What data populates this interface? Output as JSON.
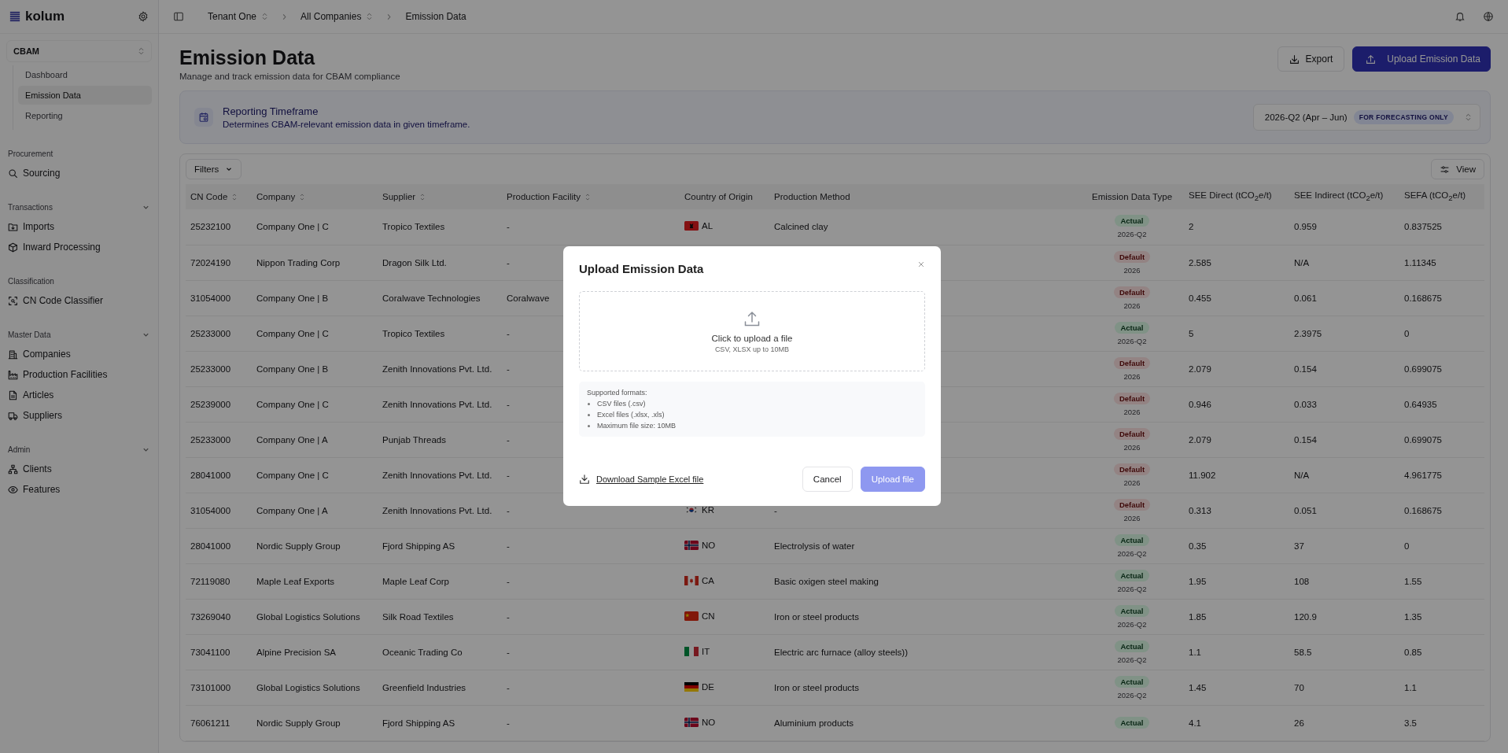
{
  "sidebar": {
    "brand": "kolum",
    "module": "CBAM",
    "module_items": [
      {
        "label": "Dashboard",
        "selected": false
      },
      {
        "label": "Emission Data",
        "selected": true
      },
      {
        "label": "Reporting",
        "selected": false
      }
    ],
    "groups": [
      {
        "title": "Procurement",
        "collapsible": false,
        "items": [
          {
            "label": "Sourcing",
            "kind": "search"
          }
        ]
      },
      {
        "title": "Transactions",
        "collapsible": true,
        "items": [
          {
            "label": "Imports",
            "kind": "folder"
          },
          {
            "label": "Inward Processing",
            "kind": "cube"
          }
        ]
      },
      {
        "title": "Classification",
        "collapsible": false,
        "items": [
          {
            "label": "CN Code Classifier",
            "kind": "scan"
          }
        ]
      },
      {
        "title": "Master Data",
        "collapsible": true,
        "items": [
          {
            "label": "Companies",
            "kind": "building"
          },
          {
            "label": "Production Facilities",
            "kind": "factory"
          },
          {
            "label": "Articles",
            "kind": "file"
          },
          {
            "label": "Suppliers",
            "kind": "truck"
          }
        ]
      },
      {
        "title": "Admin",
        "collapsible": true,
        "items": [
          {
            "label": "Clients",
            "kind": "network"
          },
          {
            "label": "Features",
            "kind": "eye"
          }
        ]
      }
    ]
  },
  "breadcrumb": [
    {
      "label": "Tenant One",
      "switcher": true
    },
    {
      "label": "All Companies",
      "switcher": true
    },
    {
      "label": "Emission Data",
      "switcher": false
    }
  ],
  "page": {
    "title": "Emission Data",
    "subtitle": "Manage and track emission data for CBAM compliance",
    "buttons": [
      {
        "label": "Export",
        "kind": "export"
      },
      {
        "label": "Upload Emission Data",
        "kind": "upload"
      }
    ]
  },
  "timeframe": {
    "title": "Reporting Timeframe",
    "description": "Determines CBAM-relevant emission data in given timeframe.",
    "value": "2026-Q2 (Apr – Jun)",
    "badge": "FOR FORECASTING ONLY"
  },
  "toolbar": {
    "filters": "Filters",
    "view": "View"
  },
  "table": {
    "columns": [
      {
        "label": "CN Code",
        "sortable": true
      },
      {
        "label": "Company",
        "sortable": true
      },
      {
        "label": "Supplier",
        "sortable": true
      },
      {
        "label": "Production Facility",
        "sortable": true
      },
      {
        "label": "Country of Origin",
        "sortable": false
      },
      {
        "label": "Production Method",
        "sortable": false
      },
      {
        "label": "Emission Data Type",
        "sortable": false
      },
      {
        "label": "SEE Direct (tCO$_{2}$e/t)",
        "sortable": false
      },
      {
        "label": "SEE Indirect (tCO$_{2}$e/t)",
        "sortable": false
      },
      {
        "label": "SEFA (tCO$_{2}$e/t)",
        "sortable": false
      }
    ],
    "rows": [
      {
        "cn": "25232100",
        "company": "Company One | C",
        "supplier": "Tropico Textiles",
        "facility": "-",
        "country": {
          "code": "AL",
          "kind": "al"
        },
        "method": "Calcined clay",
        "type": {
          "label": "Actual",
          "period": "2026-Q2",
          "kind": "actual"
        },
        "direct": "2",
        "indirect": "0.959",
        "sefa": "0.837525"
      },
      {
        "cn": "72024190",
        "company": "Nippon Trading Corp",
        "supplier": "Dragon Silk Ltd.",
        "facility": "-",
        "type": {
          "label": "Default",
          "period": "2026",
          "kind": "default"
        },
        "direct": "2.585",
        "indirect": "N/A",
        "sefa": "1.11345"
      },
      {
        "cn": "31054000",
        "company": "Company One | B",
        "supplier": "Coralwave Technologies",
        "facility": "Coralwave",
        "type": {
          "label": "Default",
          "period": "2026",
          "kind": "default"
        },
        "direct": "0.455",
        "indirect": "0.061",
        "sefa": "0.168675"
      },
      {
        "cn": "25233000",
        "company": "Company One | C",
        "supplier": "Tropico Textiles",
        "facility": "-",
        "type": {
          "label": "Actual",
          "period": "2026-Q2",
          "kind": "actual"
        },
        "direct": "5",
        "indirect": "2.3975",
        "sefa": "0"
      },
      {
        "cn": "25233000",
        "company": "Company One | B",
        "supplier": "Zenith Innovations Pvt. Ltd.",
        "facility": "-",
        "type": {
          "label": "Default",
          "period": "2026",
          "kind": "default"
        },
        "direct": "2.079",
        "indirect": "0.154",
        "sefa": "0.699075"
      },
      {
        "cn": "25239000",
        "company": "Company One | C",
        "supplier": "Zenith Innovations Pvt. Ltd.",
        "facility": "-",
        "type": {
          "label": "Default",
          "period": "2026",
          "kind": "default"
        },
        "direct": "0.946",
        "indirect": "0.033",
        "sefa": "0.64935"
      },
      {
        "cn": "25233000",
        "company": "Company One | A",
        "supplier": "Punjab Threads",
        "facility": "-",
        "type": {
          "label": "Default",
          "period": "2026",
          "kind": "default"
        },
        "direct": "2.079",
        "indirect": "0.154",
        "sefa": "0.699075"
      },
      {
        "cn": "28041000",
        "company": "Company One | C",
        "supplier": "Zenith Innovations Pvt. Ltd.",
        "facility": "-",
        "type": {
          "label": "Default",
          "period": "2026",
          "kind": "default"
        },
        "direct": "11.902",
        "indirect": "N/A",
        "sefa": "4.961775"
      },
      {
        "cn": "31054000",
        "company": "Company One | A",
        "supplier": "Zenith Innovations Pvt. Ltd.",
        "facility": "-",
        "country": {
          "code": "KR",
          "kind": "kr"
        },
        "method": "-",
        "type": {
          "label": "Default",
          "period": "2026",
          "kind": "default"
        },
        "direct": "0.313",
        "indirect": "0.051",
        "sefa": "0.168675"
      },
      {
        "cn": "28041000",
        "company": "Nordic Supply Group",
        "supplier": "Fjord Shipping AS",
        "facility": "-",
        "country": {
          "code": "NO",
          "kind": "no"
        },
        "method": "Electrolysis of water",
        "type": {
          "label": "Actual",
          "period": "2026-Q2",
          "kind": "actual"
        },
        "direct": "0.35",
        "indirect": "37",
        "sefa": "0"
      },
      {
        "cn": "72119080",
        "company": "Maple Leaf Exports",
        "supplier": "Maple Leaf Corp",
        "facility": "-",
        "country": {
          "code": "CA",
          "kind": "ca"
        },
        "method": "Basic oxigen steel making",
        "type": {
          "label": "Actual",
          "period": "2026-Q2",
          "kind": "actual"
        },
        "direct": "1.95",
        "indirect": "108",
        "sefa": "1.55"
      },
      {
        "cn": "73269040",
        "company": "Global Logistics Solutions",
        "supplier": "Silk Road Textiles",
        "facility": "-",
        "country": {
          "code": "CN",
          "kind": "cn"
        },
        "method": "Iron or steel products",
        "type": {
          "label": "Actual",
          "period": "2026-Q2",
          "kind": "actual"
        },
        "direct": "1.85",
        "indirect": "120.9",
        "sefa": "1.35"
      },
      {
        "cn": "73041100",
        "company": "Alpine Precision SA",
        "supplier": "Oceanic Trading Co",
        "facility": "-",
        "country": {
          "code": "IT",
          "kind": "it"
        },
        "method": "Electric arc furnace (alloy steels))",
        "type": {
          "label": "Actual",
          "period": "2026-Q2",
          "kind": "actual"
        },
        "direct": "1.1",
        "indirect": "58.5",
        "sefa": "0.85"
      },
      {
        "cn": "73101000",
        "company": "Global Logistics Solutions",
        "supplier": "Greenfield Industries",
        "facility": "-",
        "country": {
          "code": "DE",
          "kind": "de"
        },
        "method": "Iron or steel products",
        "type": {
          "label": "Actual",
          "period": "2026-Q2",
          "kind": "actual"
        },
        "direct": "1.45",
        "indirect": "70",
        "sefa": "1.1"
      },
      {
        "cn": "76061211",
        "company": "Nordic Supply Group",
        "supplier": "Fjord Shipping AS",
        "facility": "-",
        "country": {
          "code": "NO",
          "kind": "no"
        },
        "method": "Aluminium products",
        "type": {
          "label": "Actual",
          "kind": "actual"
        },
        "direct": "4.1",
        "indirect": "26",
        "sefa": "3.5"
      }
    ]
  },
  "dialog": {
    "title": "Upload Emission Data",
    "drop_title": "Click to upload a file",
    "drop_hint": "CSV, XLSX up to 10MB",
    "formats_title": "Supported formats:",
    "formats": [
      "CSV files (.csv)",
      "Excel files (.xlsx, .xls)",
      "Maximum file size: 10MB"
    ],
    "download_link": "Download Sample Excel file",
    "cancel": "Cancel",
    "upload": {
      "label": "Upload file",
      "disabled": true
    }
  }
}
